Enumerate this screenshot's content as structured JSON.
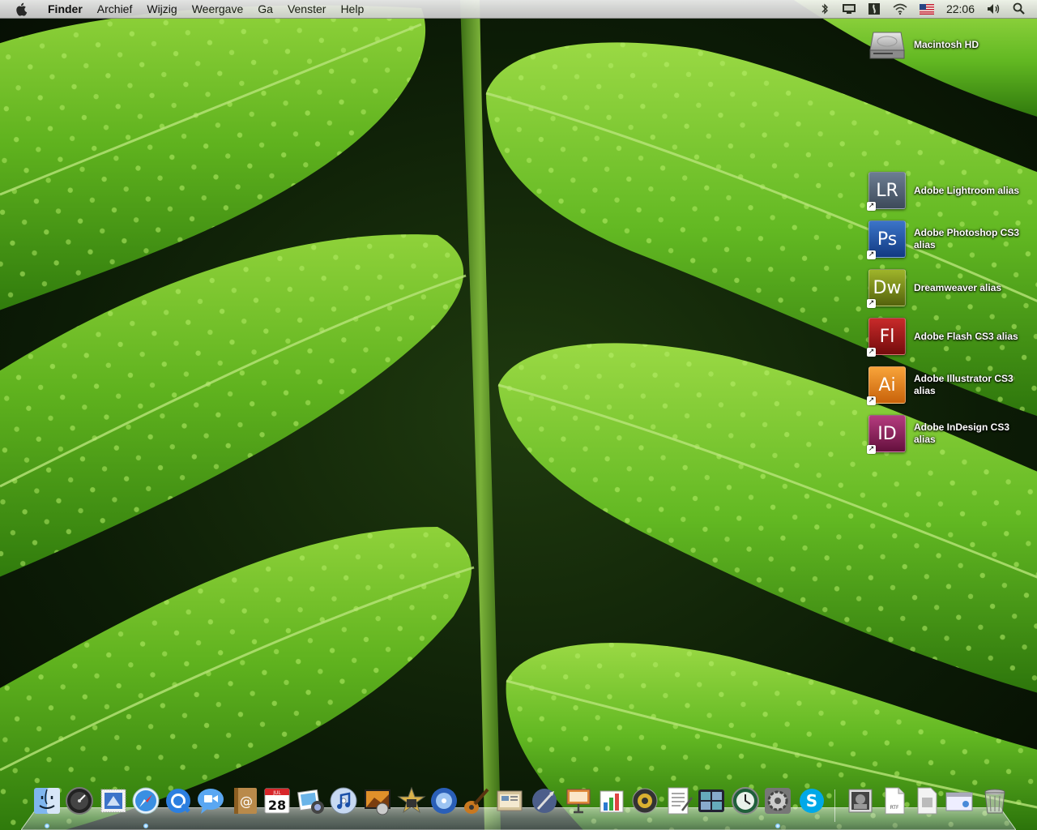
{
  "menubar": {
    "app_name": "Finder",
    "menus": [
      "Archief",
      "Wijzig",
      "Weergave",
      "Ga",
      "Venster",
      "Help"
    ],
    "extras": [
      "bluetooth-icon",
      "display-icon",
      "script-icon",
      "wifi-icon",
      "us-flag-icon"
    ],
    "clock": "22:06"
  },
  "desktop": {
    "drive": {
      "label": "Macintosh HD"
    },
    "aliases": [
      {
        "abbr": "LR",
        "label": "Adobe Lightroom alias",
        "color": "#4d5b6e"
      },
      {
        "abbr": "Ps",
        "label": "Adobe Photoshop CS3 alias",
        "color": "#1f4fa0"
      },
      {
        "abbr": "Dw",
        "label": "Dreamweaver alias",
        "color": "#7a8b17"
      },
      {
        "abbr": "Fl",
        "label": "Adobe Flash CS3 alias",
        "color": "#a11616"
      },
      {
        "abbr": "Ai",
        "label": "Adobe Illustrator CS3 alias",
        "color": "#e8870e"
      },
      {
        "abbr": "ID",
        "label": "Adobe InDesign CS3 alias",
        "color": "#8d1a58"
      }
    ]
  },
  "dock": {
    "calendar_day": "28",
    "calendar_month": "JUL",
    "items": [
      "finder-icon",
      "dashboard-icon",
      "mail-stamp-icon",
      "safari-icon",
      "quicktime-icon",
      "ichat-icon",
      "address-book-icon",
      "ical-icon",
      "iphoto-icon",
      "itunes-icon",
      "photo-booth-icon",
      "imovie-icon",
      "idvd-icon",
      "garageband-icon",
      "iweb-icon",
      "script-editor-icon",
      "keynote-icon",
      "numbers-icon",
      "system-utility-icon",
      "textedit-icon",
      "spaces-icon",
      "time-machine-icon",
      "system-preferences-icon",
      "skype-icon",
      "downloads-stack-icon",
      "rtf-document-icon",
      "file-stack-icon",
      "finder-window-stack-icon",
      "trash-icon"
    ]
  }
}
